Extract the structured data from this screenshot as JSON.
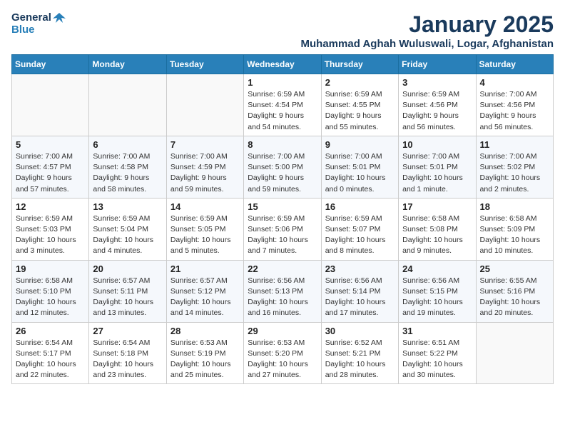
{
  "header": {
    "logo_line1": "General",
    "logo_line2": "Blue",
    "title": "January 2025",
    "subtitle": "Muhammad Aghah Wuluswali, Logar, Afghanistan"
  },
  "weekdays": [
    "Sunday",
    "Monday",
    "Tuesday",
    "Wednesday",
    "Thursday",
    "Friday",
    "Saturday"
  ],
  "weeks": [
    [
      {
        "day": "",
        "info": ""
      },
      {
        "day": "",
        "info": ""
      },
      {
        "day": "",
        "info": ""
      },
      {
        "day": "1",
        "info": "Sunrise: 6:59 AM\nSunset: 4:54 PM\nDaylight: 9 hours\nand 54 minutes."
      },
      {
        "day": "2",
        "info": "Sunrise: 6:59 AM\nSunset: 4:55 PM\nDaylight: 9 hours\nand 55 minutes."
      },
      {
        "day": "3",
        "info": "Sunrise: 6:59 AM\nSunset: 4:56 PM\nDaylight: 9 hours\nand 56 minutes."
      },
      {
        "day": "4",
        "info": "Sunrise: 7:00 AM\nSunset: 4:56 PM\nDaylight: 9 hours\nand 56 minutes."
      }
    ],
    [
      {
        "day": "5",
        "info": "Sunrise: 7:00 AM\nSunset: 4:57 PM\nDaylight: 9 hours\nand 57 minutes."
      },
      {
        "day": "6",
        "info": "Sunrise: 7:00 AM\nSunset: 4:58 PM\nDaylight: 9 hours\nand 58 minutes."
      },
      {
        "day": "7",
        "info": "Sunrise: 7:00 AM\nSunset: 4:59 PM\nDaylight: 9 hours\nand 59 minutes."
      },
      {
        "day": "8",
        "info": "Sunrise: 7:00 AM\nSunset: 5:00 PM\nDaylight: 9 hours\nand 59 minutes."
      },
      {
        "day": "9",
        "info": "Sunrise: 7:00 AM\nSunset: 5:01 PM\nDaylight: 10 hours\nand 0 minutes."
      },
      {
        "day": "10",
        "info": "Sunrise: 7:00 AM\nSunset: 5:01 PM\nDaylight: 10 hours\nand 1 minute."
      },
      {
        "day": "11",
        "info": "Sunrise: 7:00 AM\nSunset: 5:02 PM\nDaylight: 10 hours\nand 2 minutes."
      }
    ],
    [
      {
        "day": "12",
        "info": "Sunrise: 6:59 AM\nSunset: 5:03 PM\nDaylight: 10 hours\nand 3 minutes."
      },
      {
        "day": "13",
        "info": "Sunrise: 6:59 AM\nSunset: 5:04 PM\nDaylight: 10 hours\nand 4 minutes."
      },
      {
        "day": "14",
        "info": "Sunrise: 6:59 AM\nSunset: 5:05 PM\nDaylight: 10 hours\nand 5 minutes."
      },
      {
        "day": "15",
        "info": "Sunrise: 6:59 AM\nSunset: 5:06 PM\nDaylight: 10 hours\nand 7 minutes."
      },
      {
        "day": "16",
        "info": "Sunrise: 6:59 AM\nSunset: 5:07 PM\nDaylight: 10 hours\nand 8 minutes."
      },
      {
        "day": "17",
        "info": "Sunrise: 6:58 AM\nSunset: 5:08 PM\nDaylight: 10 hours\nand 9 minutes."
      },
      {
        "day": "18",
        "info": "Sunrise: 6:58 AM\nSunset: 5:09 PM\nDaylight: 10 hours\nand 10 minutes."
      }
    ],
    [
      {
        "day": "19",
        "info": "Sunrise: 6:58 AM\nSunset: 5:10 PM\nDaylight: 10 hours\nand 12 minutes."
      },
      {
        "day": "20",
        "info": "Sunrise: 6:57 AM\nSunset: 5:11 PM\nDaylight: 10 hours\nand 13 minutes."
      },
      {
        "day": "21",
        "info": "Sunrise: 6:57 AM\nSunset: 5:12 PM\nDaylight: 10 hours\nand 14 minutes."
      },
      {
        "day": "22",
        "info": "Sunrise: 6:56 AM\nSunset: 5:13 PM\nDaylight: 10 hours\nand 16 minutes."
      },
      {
        "day": "23",
        "info": "Sunrise: 6:56 AM\nSunset: 5:14 PM\nDaylight: 10 hours\nand 17 minutes."
      },
      {
        "day": "24",
        "info": "Sunrise: 6:56 AM\nSunset: 5:15 PM\nDaylight: 10 hours\nand 19 minutes."
      },
      {
        "day": "25",
        "info": "Sunrise: 6:55 AM\nSunset: 5:16 PM\nDaylight: 10 hours\nand 20 minutes."
      }
    ],
    [
      {
        "day": "26",
        "info": "Sunrise: 6:54 AM\nSunset: 5:17 PM\nDaylight: 10 hours\nand 22 minutes."
      },
      {
        "day": "27",
        "info": "Sunrise: 6:54 AM\nSunset: 5:18 PM\nDaylight: 10 hours\nand 23 minutes."
      },
      {
        "day": "28",
        "info": "Sunrise: 6:53 AM\nSunset: 5:19 PM\nDaylight: 10 hours\nand 25 minutes."
      },
      {
        "day": "29",
        "info": "Sunrise: 6:53 AM\nSunset: 5:20 PM\nDaylight: 10 hours\nand 27 minutes."
      },
      {
        "day": "30",
        "info": "Sunrise: 6:52 AM\nSunset: 5:21 PM\nDaylight: 10 hours\nand 28 minutes."
      },
      {
        "day": "31",
        "info": "Sunrise: 6:51 AM\nSunset: 5:22 PM\nDaylight: 10 hours\nand 30 minutes."
      },
      {
        "day": "",
        "info": ""
      }
    ]
  ]
}
